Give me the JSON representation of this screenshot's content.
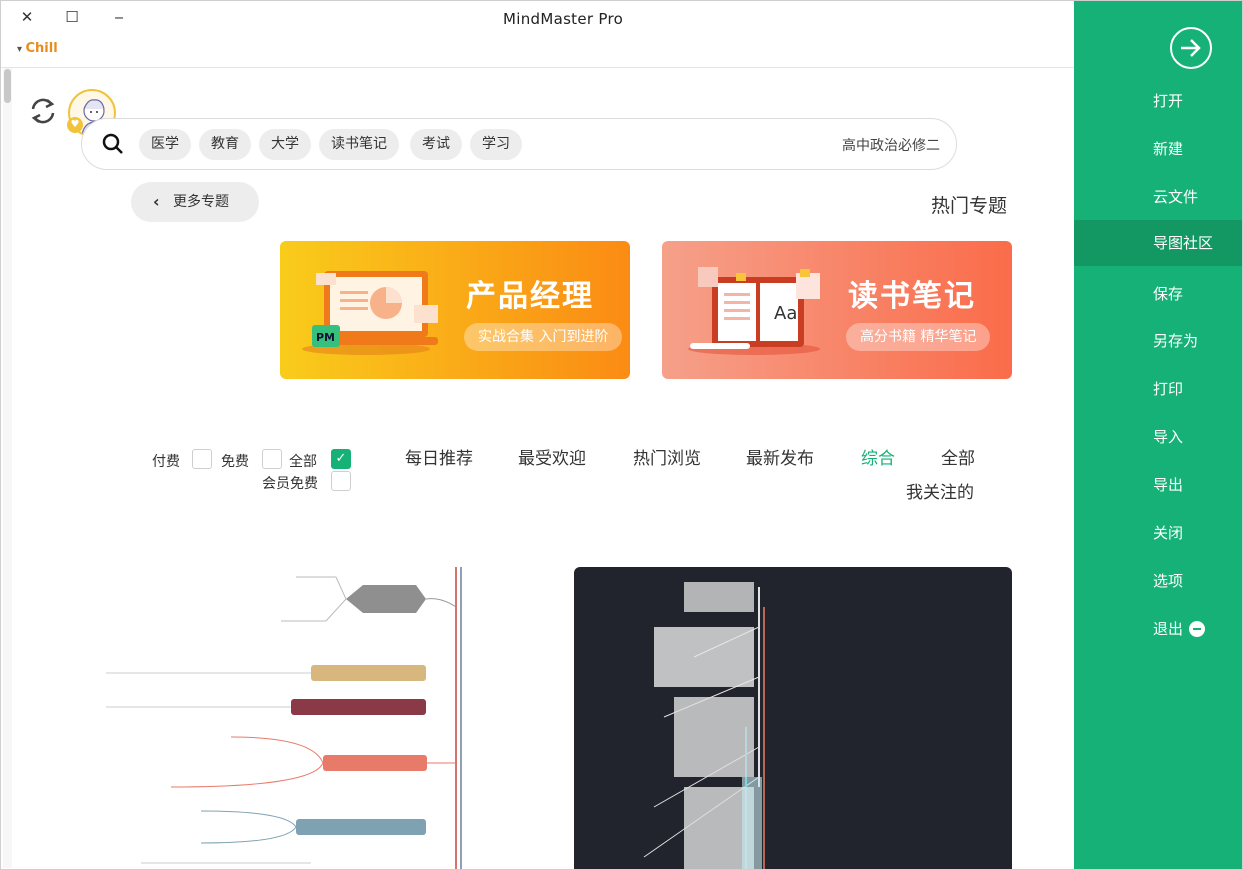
{
  "window": {
    "title": "MindMaster Pro",
    "user": "Chill",
    "controls": {
      "minimize": "‒",
      "maximize": "☐",
      "close": "✕"
    }
  },
  "sidebar": {
    "items": [
      {
        "label": "打开"
      },
      {
        "label": "新建"
      },
      {
        "label": "云文件"
      },
      {
        "label": "导图社区",
        "active": true
      },
      {
        "label": "保存"
      },
      {
        "label": "另存为"
      },
      {
        "label": "打印"
      },
      {
        "label": "导入"
      },
      {
        "label": "导出"
      },
      {
        "label": "关闭"
      },
      {
        "label": "选项"
      },
      {
        "label": "退出"
      }
    ]
  },
  "search": {
    "value": "高中政治必修二",
    "tags": [
      "学习",
      "考试",
      "读书笔记",
      "大学",
      "教育",
      "医学"
    ]
  },
  "hot": {
    "title": "热门专题",
    "more": "更多专题",
    "banners": [
      {
        "title": "读书笔记",
        "subtitle": "高分书籍 精华笔记"
      },
      {
        "title": "产品经理",
        "subtitle": "实战合集 入门到进阶"
      }
    ]
  },
  "filters": {
    "tabs": [
      "全部",
      "综合",
      "最新发布",
      "热门浏览",
      "最受欢迎",
      "每日推荐"
    ],
    "active_tab": "综合",
    "follow_tab": "我关注的",
    "price": {
      "all": "全部",
      "free": "免费",
      "paid": "付费",
      "member_free": "会员免费"
    }
  },
  "colors": {
    "sidebar": "#16b177",
    "sidebar_active": "#139863",
    "accent_orange": "#e98b1e"
  }
}
